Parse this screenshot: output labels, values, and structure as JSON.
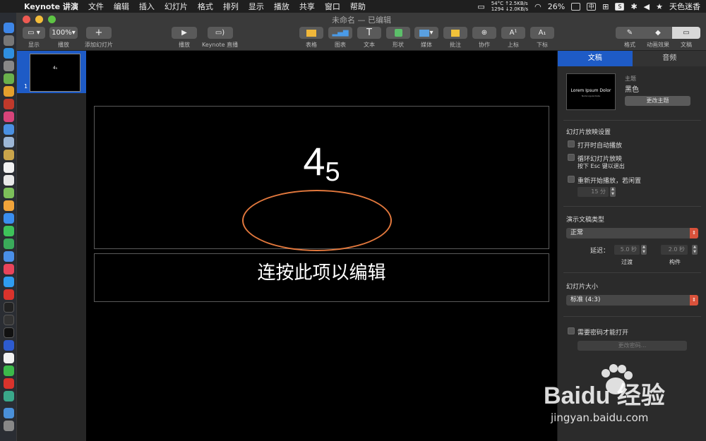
{
  "menubar": {
    "app_name": "Keynote 讲演",
    "items": [
      "文件",
      "编辑",
      "插入",
      "幻灯片",
      "格式",
      "排列",
      "显示",
      "播放",
      "共享",
      "窗口",
      "帮助"
    ],
    "net_line1": "54°C ↑2.5KB/s",
    "net_line2": "1294 ↓2.0KB/s",
    "battery": "26%",
    "input_char": "中",
    "user": "天色迷香"
  },
  "window": {
    "title": "未命名 — 已编辑"
  },
  "toolbar": {
    "view_label": "显示",
    "zoom_value": "100%",
    "zoom_label": "播放",
    "add_slide_label": "添加幻灯片",
    "play_label": "播放",
    "live_label": "Keynote 直播",
    "table_label": "表格",
    "chart_label": "图表",
    "text_label": "文本",
    "shape_label": "形状",
    "media_label": "媒体",
    "comment_label": "批注",
    "collab_label": "协作",
    "superscript_label": "上标",
    "subscript_label": "下标",
    "format_label": "格式",
    "animate_label": "动画效果",
    "document_label": "文稿"
  },
  "navigator": {
    "slide_number": "1",
    "thumb_text": "4₅"
  },
  "slide": {
    "title_main": "4",
    "title_sub": "5",
    "body_placeholder": "连按此项以编辑"
  },
  "inspector": {
    "tabs": [
      "文稿",
      "音频"
    ],
    "theme_heading": "主题",
    "theme_name": "黑色",
    "theme_thumb_title": "Lorem Ipsum Dolor",
    "theme_thumb_sub": "Nulla Ligula Nulla",
    "change_theme": "更改主题",
    "slideshow_settings": "幻灯片放映设置",
    "autoplay": "打开时自动播放",
    "loop": "循环幻灯片放映",
    "loop_hint": "按下 Esc 键以退出",
    "restart": "重新开始播放，若闲置",
    "idle_value": "15 分",
    "presentation_type": "演示文稿类型",
    "type_value": "正常",
    "delay_label": "延迟：",
    "transition_value": "5.0 秒",
    "build_value": "2.0 秒",
    "transition_label": "过渡",
    "build_label": "构件",
    "slide_size": "幻灯片大小",
    "size_value": "标准 (4:3)",
    "require_password": "需要密码才能打开",
    "change_password": "更改密码..."
  },
  "watermark": {
    "brand": "Baidu 经验",
    "site": "jingyan.baidu.com"
  },
  "colors": {
    "accent_blue": "#1e5bc6",
    "annotation_orange": "#e2783d",
    "popup_red": "#d9523b"
  }
}
